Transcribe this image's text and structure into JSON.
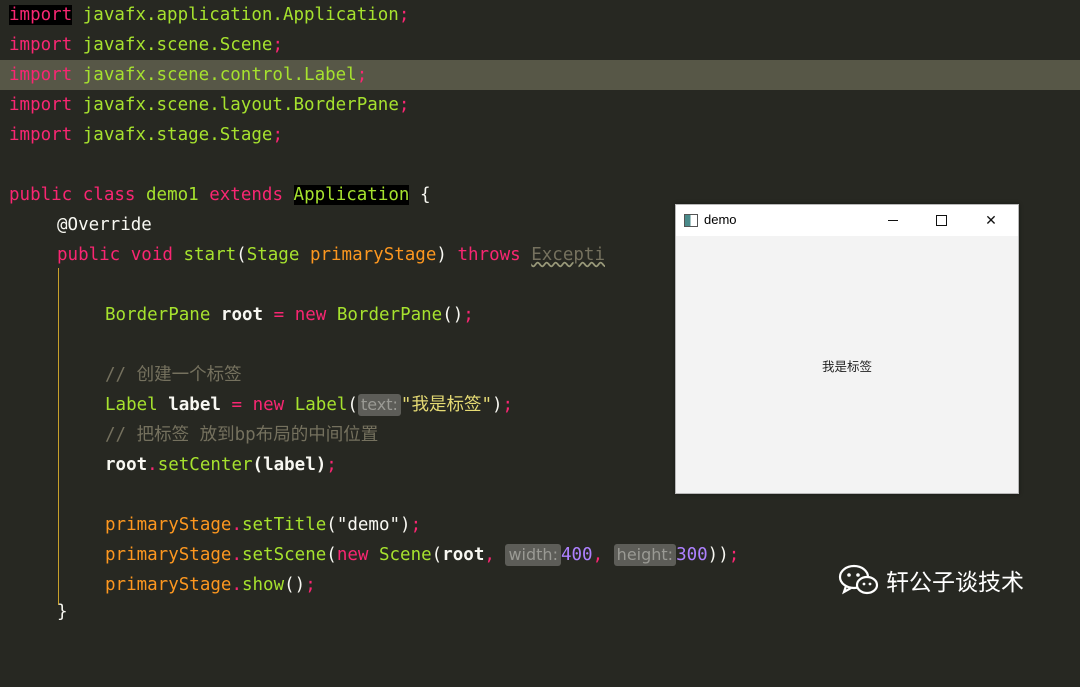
{
  "editor": {
    "imports": [
      {
        "kw": "import",
        "pkg": "javafx",
        "rest": ".application.",
        "cls": "Application"
      },
      {
        "kw": "import",
        "pkg": "javafx",
        "rest": ".scene.",
        "cls": "Scene"
      },
      {
        "kw": "import",
        "pkg": "javafx",
        "rest": ".scene.control.",
        "cls": "Label"
      },
      {
        "kw": "import",
        "pkg": "javafx",
        "rest": ".scene.layout.",
        "cls": "BorderPane"
      },
      {
        "kw": "import",
        "pkg": "javafx",
        "rest": ".stage.",
        "cls": "Stage"
      }
    ],
    "class_decl": {
      "public": "public",
      "class": "class",
      "name": "demo1",
      "extends": "extends",
      "parent": "Application",
      "brace": "{"
    },
    "annotation": "@Override",
    "method_sig": {
      "public": "public",
      "void": "void",
      "name": "start",
      "param_open": "(",
      "param_type": "Stage",
      "param_name": "primaryStage",
      "param_close": ")",
      "throws": "throws",
      "exception": "Excepti"
    },
    "line_root": {
      "type": "BorderPane",
      "var": "root",
      "eq": "=",
      "new": "new",
      "ctor": "BorderPane",
      "tail": "()"
    },
    "comment1": "// 创建一个标签",
    "line_label": {
      "type": "Label",
      "var": "label",
      "eq": "=",
      "new": "new",
      "ctor": "Label",
      "open": "(",
      "hint": "text:",
      "str": "\"我是标签\"",
      "close": ")"
    },
    "comment2": "// 把标签 放到bp布局的中间位置",
    "line_center": {
      "obj": "root",
      "method": "setCenter",
      "args": "(label)"
    },
    "line_title": {
      "obj": "primaryStage",
      "method": "setTitle",
      "open": "(",
      "str": "\"demo\"",
      "close": ")"
    },
    "line_scene": {
      "obj": "primaryStage",
      "method": "setScene",
      "open": "(",
      "new": "new",
      "ctor": "Scene",
      "open2": "(",
      "root": "root",
      "hint_w": "width:",
      "w": "400",
      "hint_h": "height:",
      "h": "300",
      "close": "))"
    },
    "line_show": {
      "obj": "primaryStage",
      "method": "show",
      "tail": "()"
    },
    "closing_brace": "}"
  },
  "window": {
    "title": "demo",
    "label_text": "我是标签",
    "minimize_glyph": "—",
    "close_glyph": "✕"
  },
  "watermark": {
    "text": "轩公子谈技术"
  }
}
